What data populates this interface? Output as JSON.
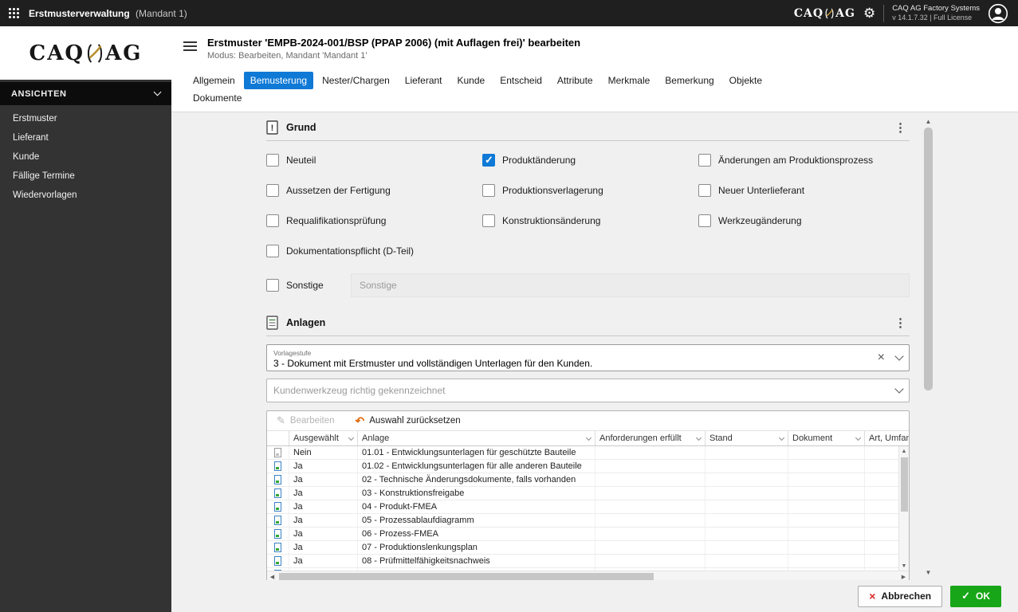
{
  "topbar": {
    "title": "Erstmusterverwaltung",
    "title_suffix": "(Mandant 1)",
    "logo": {
      "caq": "CAQ",
      "ag": "AG"
    },
    "info_line1": "CAQ AG Factory Systems",
    "info_line2": "v 14.1.7.32 | Full License"
  },
  "sidebar": {
    "logo": {
      "caq": "CAQ",
      "ag": "AG"
    },
    "section": "ANSICHTEN",
    "items": [
      "Erstmuster",
      "Lieferant",
      "Kunde",
      "Fällige Termine",
      "Wiedervorlagen"
    ]
  },
  "header": {
    "title": "Erstmuster 'EMPB-2024-001/BSP (PPAP 2006) (mit Auflagen frei)' bearbeiten",
    "subtitle": "Modus: Bearbeiten, Mandant 'Mandant 1'"
  },
  "tabs": {
    "row1": [
      {
        "label": "Allgemein",
        "active": false
      },
      {
        "label": "Bemusterung",
        "active": true
      },
      {
        "label": "Nester/Chargen",
        "active": false
      },
      {
        "label": "Lieferant",
        "active": false
      },
      {
        "label": "Kunde",
        "active": false
      },
      {
        "label": "Entscheid",
        "active": false
      },
      {
        "label": "Attribute",
        "active": false
      },
      {
        "label": "Merkmale",
        "active": false
      },
      {
        "label": "Bemerkung",
        "active": false
      },
      {
        "label": "Objekte",
        "active": false
      }
    ],
    "row2": [
      {
        "label": "Dokumente",
        "active": false
      }
    ]
  },
  "grund": {
    "title": "Grund",
    "checkboxes": [
      {
        "label": "Neuteil",
        "checked": false
      },
      {
        "label": "Produktänderung",
        "checked": true
      },
      {
        "label": "Änderungen am Produktionsprozess",
        "checked": false
      },
      {
        "label": "Aussetzen der Fertigung",
        "checked": false
      },
      {
        "label": "Produktionsverlagerung",
        "checked": false
      },
      {
        "label": "Neuer Unterlieferant",
        "checked": false
      },
      {
        "label": "Requalifikationsprüfung",
        "checked": false
      },
      {
        "label": "Konstruktionsänderung",
        "checked": false
      },
      {
        "label": "Werkzeugänderung",
        "checked": false
      },
      {
        "label": "Dokumentationspflicht (D-Teil)",
        "checked": false
      },
      {
        "label": "Sonstige",
        "checked": false
      }
    ],
    "sonstige_placeholder": "Sonstige"
  },
  "anlagen": {
    "title": "Anlagen",
    "vorlagestufe": {
      "label": "Vorlagestufe",
      "value": "3 - Dokument mit Erstmuster und vollständigen Unterlagen für den Kunden."
    },
    "kundenwerkzeug_placeholder": "Kundenwerkzeug richtig gekennzeichnet",
    "toolbar": {
      "bearbeiten": "Bearbeiten",
      "zuruecksetzen": "Auswahl zurücksetzen"
    },
    "table": {
      "columns": [
        "Ausgewählt",
        "Anlage",
        "Anforderungen erfüllt",
        "Stand",
        "Dokument",
        "Art, Umfang"
      ],
      "rows": [
        {
          "selected": "Nein",
          "anlage": "01.01 - Entwicklungsunterlagen für geschützte Bauteile"
        },
        {
          "selected": "Ja",
          "anlage": "01.02 - Entwicklungsunterlagen für alle anderen Bauteile"
        },
        {
          "selected": "Ja",
          "anlage": "02 - Technische Änderungsdokumente, falls vorhanden"
        },
        {
          "selected": "Ja",
          "anlage": "03 - Konstruktionsfreigabe"
        },
        {
          "selected": "Ja",
          "anlage": "04 - Produkt-FMEA"
        },
        {
          "selected": "Ja",
          "anlage": "05 - Prozessablaufdiagramm"
        },
        {
          "selected": "Ja",
          "anlage": "06 - Prozess-FMEA"
        },
        {
          "selected": "Ja",
          "anlage": "07 - Produktionslenkungsplan"
        },
        {
          "selected": "Ja",
          "anlage": "08 - Prüfmittelfähigkeitsnachweis"
        }
      ]
    }
  },
  "footer": {
    "cancel": "Abbrechen",
    "ok": "OK"
  },
  "icons": {
    "gear": "⚙",
    "kebab": "⋮",
    "pencil": "✎",
    "undo": "↶",
    "clear": "×",
    "cancel_x": "×",
    "ok_check": "✓",
    "grund_bang": "!"
  },
  "colors": {
    "accent_blue": "#0f79d6",
    "ok_green": "#17a617",
    "cancel_red": "#d92b2b",
    "undo_orange": "#e06a10",
    "topbar_bg": "#1f1f1f",
    "sidebar_bg": "#333333",
    "content_bg": "#f0f0f0"
  }
}
